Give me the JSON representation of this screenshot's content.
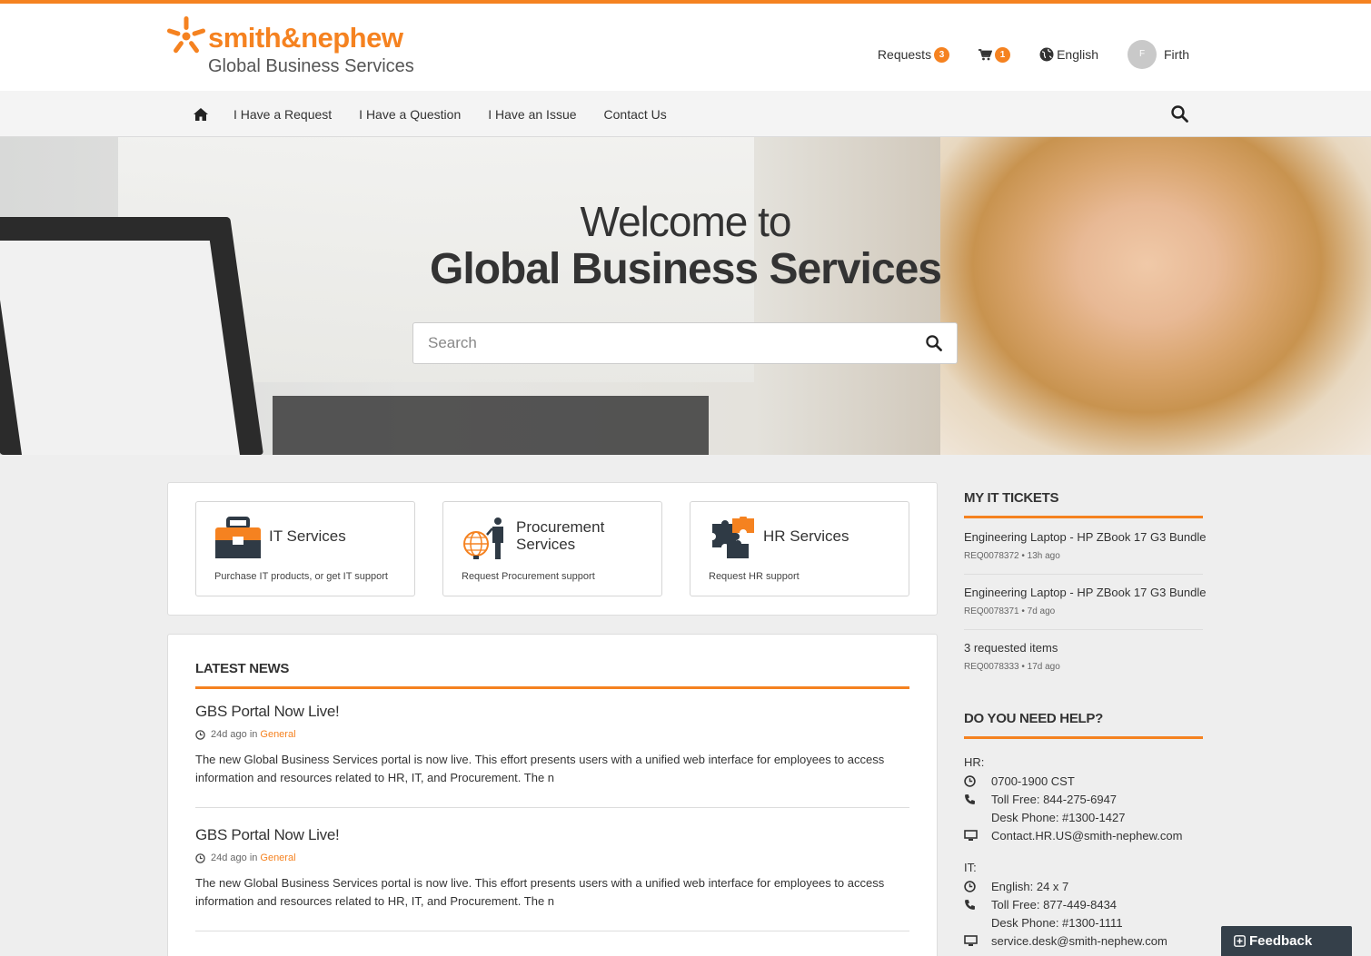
{
  "brand": {
    "name": "smith&nephew",
    "subtitle": "Global Business Services",
    "accent": "#f58220"
  },
  "topnav": {
    "requests_label": "Requests",
    "requests_count": "3",
    "cart_count": "1",
    "language": "English",
    "avatar_initial": "F",
    "user_name": "Firth"
  },
  "mainnav": {
    "items": [
      "I Have a Request",
      "I Have a Question",
      "I Have an Issue",
      "Contact Us"
    ]
  },
  "hero": {
    "line1": "Welcome to",
    "line2": "Global Business Services",
    "search_placeholder": "Search"
  },
  "services": [
    {
      "title": "IT Services",
      "desc": "Purchase IT products, or get IT support",
      "icon": "briefcase-icon"
    },
    {
      "title": "Procurement Services",
      "title_line1": "Procurement",
      "title_line2": "Services",
      "desc": "Request Procurement support",
      "icon": "globe-presenter-icon"
    },
    {
      "title": "HR Services",
      "desc": "Request HR support",
      "icon": "puzzle-icon"
    }
  ],
  "news": {
    "heading": "LATEST NEWS",
    "items": [
      {
        "title": "GBS Portal Now Live!",
        "age": "24d ago in",
        "category": "General",
        "body": "The new Global Business Services portal is now live. This effort presents users with a unified web interface for employees to access information and resources related to HR, IT, and Procurement. The n"
      },
      {
        "title": "GBS Portal Now Live!",
        "age": "24d ago in",
        "category": "General",
        "body": "The new Global Business Services portal is now live. This effort presents users with a unified web interface for employees to access information and resources related to HR, IT, and Procurement. The n"
      }
    ]
  },
  "tickets": {
    "heading": "MY IT TICKETS",
    "items": [
      {
        "title": "Engineering Laptop - HP ZBook 17 G3 Bundle",
        "meta": "REQ0078372 • 13h ago"
      },
      {
        "title": "Engineering Laptop - HP ZBook 17 G3 Bundle",
        "meta": "REQ0078371 • 7d ago"
      },
      {
        "title": "3 requested items",
        "meta": "REQ0078333 • 17d ago"
      }
    ]
  },
  "help": {
    "heading": "DO YOU NEED HELP?",
    "hr_label": "HR:",
    "hr_hours": "0700-1900 CST",
    "hr_tollfree": "Toll Free: 844-275-6947",
    "hr_desk": "Desk Phone: #1300-1427",
    "hr_email": "Contact.HR.US@smith-nephew.com",
    "it_label": "IT:",
    "it_hours": "English: 24 x 7",
    "it_tollfree": "Toll Free: 877-449-8434",
    "it_desk": "Desk Phone: #1300-1111",
    "it_email": "service.desk@smith-nephew.com"
  },
  "feedback": {
    "label": "Feedback"
  }
}
